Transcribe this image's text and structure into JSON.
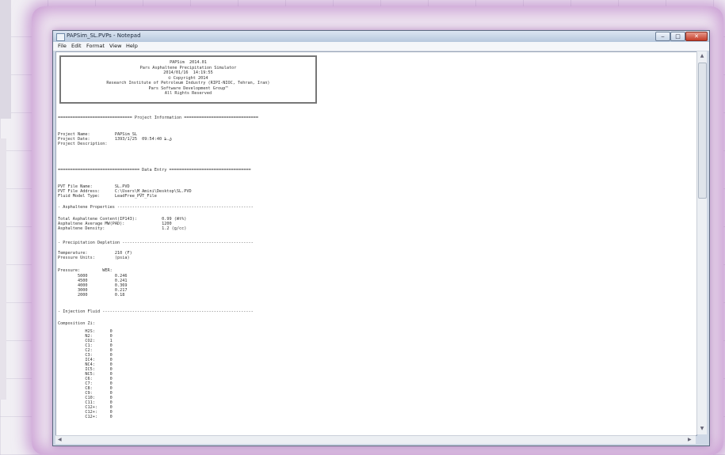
{
  "window": {
    "title": "PAPSim_SL.PVPs - Notepad",
    "controls": {
      "minimize": "‒",
      "maximize": "□",
      "close": "✕"
    }
  },
  "menu": [
    "File",
    "Edit",
    "Format",
    "View",
    "Help"
  ],
  "header_box": [
    "PAPSim  2014.01",
    "Pars Asphaltene Precipitation Simulator",
    "2014/01/16  14:19:55",
    "© Copyright 2014",
    "Research Institute of Petroleum Industry (RIPI-NIOC, Tehran, Iran)",
    "Pars Software Development Group™",
    "All Rights Reserved"
  ],
  "sections": {
    "project_info_banner": "============================== Project Information ==============================",
    "project_info_lines": [
      "Project Name:          PAPSim_SL",
      "Project Date:          1393/1/25  09:54:40 ق.ظ",
      "Project Description:"
    ],
    "data_entry_banner": "================================= Data Entry =================================",
    "data_entry_lines": [
      "PVT File Name:         SL.PVD",
      "PVT File Address:      C:\\Users\\M_Amini\\Desktop\\SL.PVD",
      "Fluid Model Type:      LeadFree_PVT_File"
    ],
    "asphaltene_banner": "- Asphaltene Properties -------------------------------------------------------",
    "asphaltene_lines": [
      "Total Asphaltene Content(IP143):          0.99 (Wt%)",
      "Asphaltene Average MW(PAD):               1200",
      "Asphaltene Density:                       1.2 (g/cc)"
    ],
    "precip_banner": "- Precipitation Depletion -----------------------------------------------------",
    "precip_lines": [
      "Temperature:           210 (F)",
      "Pressure Units:        (psia)",
      "",
      "Pressure:         WER:",
      "        5000           0.246",
      "        4500           0.241",
      "        4000           0.369",
      "        3000           0.217",
      "        2000           0.18"
    ],
    "injection_banner": "- Injection Fluid -------------------------------------------------------------",
    "injection_lines": [
      "Composition Zi:",
      "",
      "           H2S:      0",
      "           N2:       0",
      "           CO2:      1",
      "           C1:       0",
      "           C2:       0",
      "           C3:       0",
      "           IC4:      0",
      "           NC4:      0",
      "           IC5:      0",
      "           NC5:      0",
      "           C6:       0",
      "           C7:       0",
      "           C8:       0",
      "           C9:       0",
      "           C10:      0",
      "           C11:      0",
      "           C12+:     0",
      "           C12+:     0",
      "           C12+:     0"
    ]
  },
  "scrollbar": {
    "up": "▲",
    "down": "▼",
    "left": "◀",
    "right": "▶"
  }
}
